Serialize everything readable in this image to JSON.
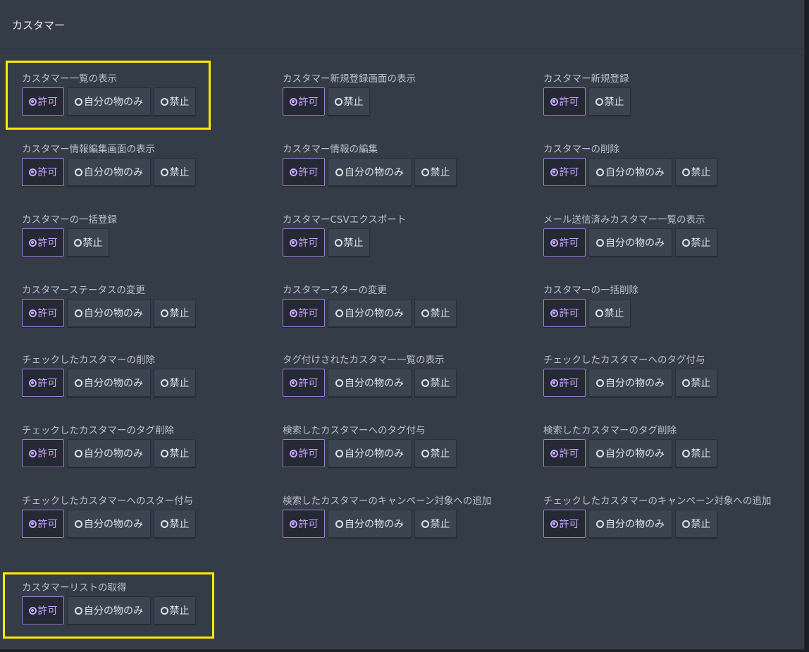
{
  "header": {
    "title": "カスタマー"
  },
  "options": {
    "allow": "許可",
    "own": "自分の物のみ",
    "deny": "禁止"
  },
  "permissions": [
    {
      "label": "カスタマー一覧の表示",
      "selected": "allow",
      "has_own": true
    },
    {
      "label": "カスタマー新規登録画面の表示",
      "selected": "allow",
      "has_own": false
    },
    {
      "label": "カスタマー新規登録",
      "selected": "allow",
      "has_own": false
    },
    {
      "label": "カスタマー情報編集画面の表示",
      "selected": "allow",
      "has_own": true
    },
    {
      "label": "カスタマー情報の編集",
      "selected": "allow",
      "has_own": true
    },
    {
      "label": "カスタマーの削除",
      "selected": "allow",
      "has_own": true
    },
    {
      "label": "カスタマーの一括登録",
      "selected": "allow",
      "has_own": false
    },
    {
      "label": "カスタマーCSVエクスポート",
      "selected": "allow",
      "has_own": false
    },
    {
      "label": "メール送信済みカスタマー一覧の表示",
      "selected": "allow",
      "has_own": true
    },
    {
      "label": "カスタマーステータスの変更",
      "selected": "allow",
      "has_own": true
    },
    {
      "label": "カスタマースターの変更",
      "selected": "allow",
      "has_own": true
    },
    {
      "label": "カスタマーの一括削除",
      "selected": "allow",
      "has_own": false
    },
    {
      "label": "チェックしたカスタマーの削除",
      "selected": "allow",
      "has_own": true
    },
    {
      "label": "タグ付けされたカスタマー一覧の表示",
      "selected": "allow",
      "has_own": true
    },
    {
      "label": "チェックしたカスタマーへのタグ付与",
      "selected": "allow",
      "has_own": true
    },
    {
      "label": "チェックしたカスタマーのタグ削除",
      "selected": "allow",
      "has_own": true
    },
    {
      "label": "検索したカスタマーへのタグ付与",
      "selected": "allow",
      "has_own": true
    },
    {
      "label": "検索したカスタマーのタグ削除",
      "selected": "allow",
      "has_own": true
    },
    {
      "label": "チェックしたカスタマーへのスター付与",
      "selected": "allow",
      "has_own": true
    },
    {
      "label": "検索したカスタマーのキャンペーン対象への追加",
      "selected": "allow",
      "has_own": true
    },
    {
      "label": "チェックしたカスタマーのキャンペーン対象への追加",
      "selected": "allow",
      "has_own": true
    },
    {
      "label": "カスタマーリストの取得",
      "selected": "allow",
      "has_own": true
    }
  ],
  "highlight_color": "#ffea00",
  "accent_color": "#9f7ed8"
}
